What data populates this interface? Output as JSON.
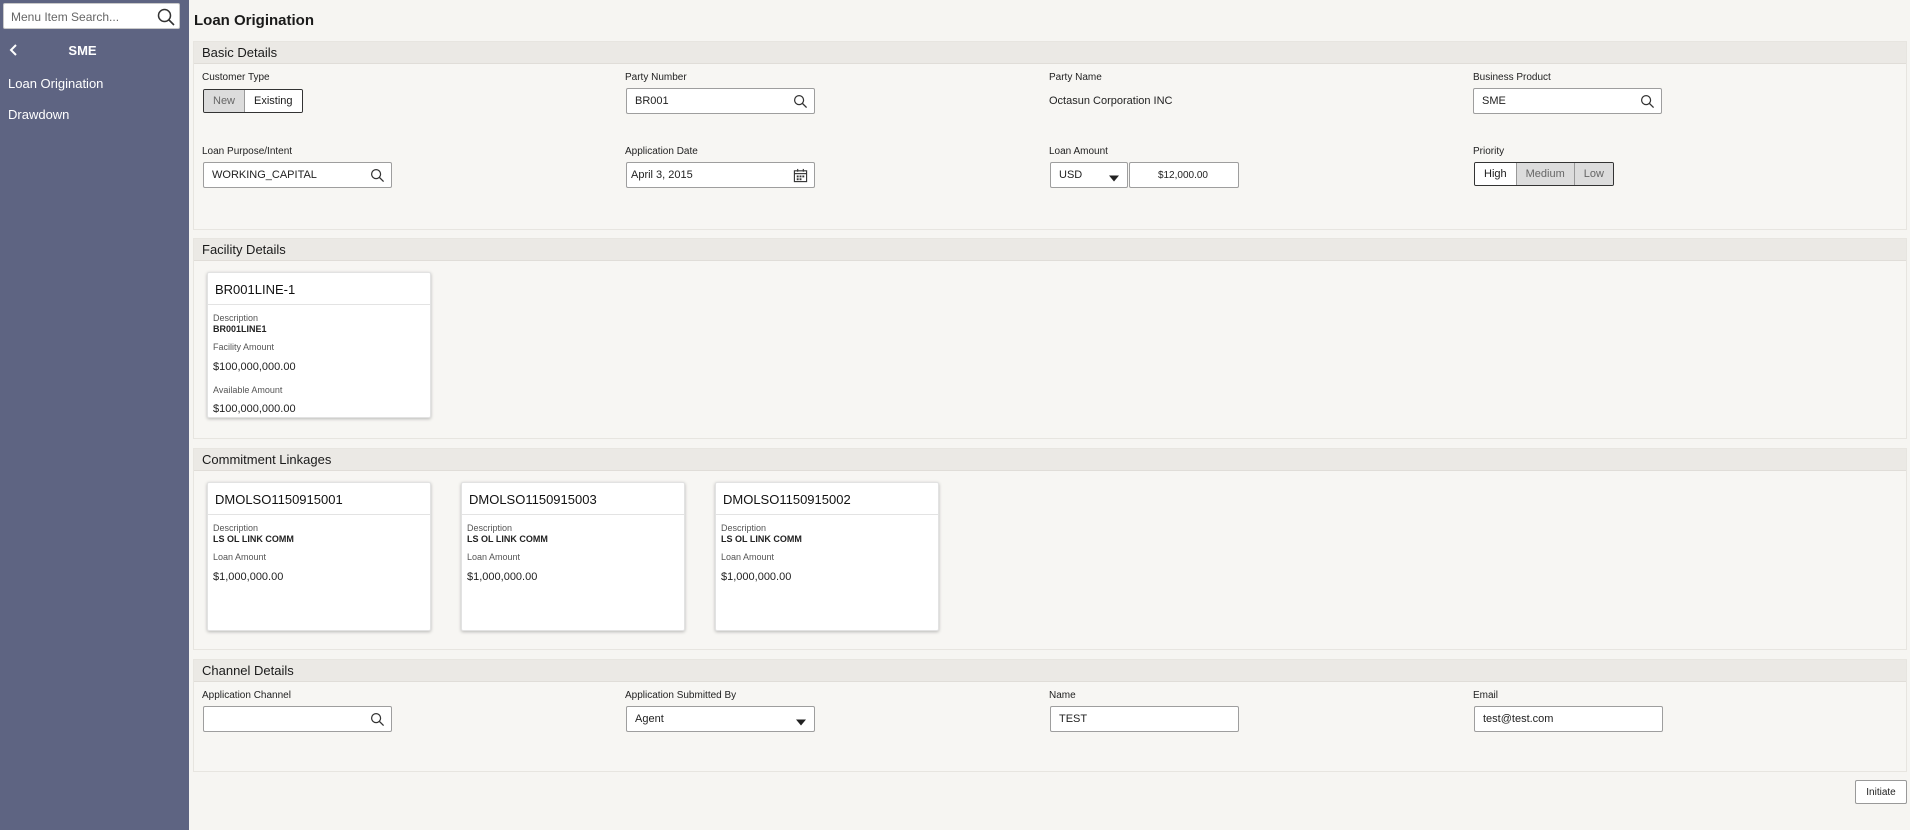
{
  "sidebar": {
    "search_placeholder": "Menu Item Search...",
    "title": "SME",
    "items": [
      {
        "label": "Loan Origination"
      },
      {
        "label": "Drawdown"
      }
    ]
  },
  "page": {
    "title": "Loan Origination"
  },
  "basic_details": {
    "title": "Basic Details",
    "customer_type": {
      "label": "Customer Type",
      "options": [
        "New",
        "Existing"
      ],
      "selected": "Existing"
    },
    "party_number": {
      "label": "Party Number",
      "value": "BR001"
    },
    "party_name": {
      "label": "Party Name",
      "value": "Octasun Corporation INC"
    },
    "business_product": {
      "label": "Business Product",
      "value": "SME"
    },
    "loan_purpose": {
      "label": "Loan Purpose/Intent",
      "value": "WORKING_CAPITAL"
    },
    "application_date": {
      "label": "Application Date",
      "value": "April 3, 2015"
    },
    "loan_amount": {
      "label": "Loan Amount",
      "currency": "USD",
      "value": "$12,000.00"
    },
    "priority": {
      "label": "Priority",
      "options": [
        "High",
        "Medium",
        "Low"
      ],
      "selected": "High"
    }
  },
  "facility_details": {
    "title": "Facility Details",
    "cards": [
      {
        "name": "BR001LINE-1",
        "description_label": "Description",
        "description": "BR001LINE1",
        "facility_amount_label": "Facility Amount",
        "facility_amount": "$100,000,000.00",
        "available_amount_label": "Available Amount",
        "available_amount": "$100,000,000.00"
      }
    ]
  },
  "commitment_linkages": {
    "title": "Commitment Linkages",
    "cards": [
      {
        "name": "DMOLSO1150915001",
        "description_label": "Description",
        "description": "LS OL LINK COMM",
        "loan_amount_label": "Loan Amount",
        "loan_amount": "$1,000,000.00"
      },
      {
        "name": "DMOLSO1150915003",
        "description_label": "Description",
        "description": "LS OL LINK COMM",
        "loan_amount_label": "Loan Amount",
        "loan_amount": "$1,000,000.00"
      },
      {
        "name": "DMOLSO1150915002",
        "description_label": "Description",
        "description": "LS OL LINK COMM",
        "loan_amount_label": "Loan Amount",
        "loan_amount": "$1,000,000.00"
      }
    ]
  },
  "channel_details": {
    "title": "Channel Details",
    "application_channel": {
      "label": "Application Channel",
      "value": ""
    },
    "submitted_by": {
      "label": "Application Submitted By",
      "value": "Agent"
    },
    "name": {
      "label": "Name",
      "value": "TEST"
    },
    "email": {
      "label": "Email",
      "value": "test@test.com"
    }
  },
  "actions": {
    "initiate_label": "Initiate"
  },
  "colors": {
    "sidebar_bg": "#5e6482",
    "section_header_bg": "#ebe9e5",
    "page_bg": "#f6f5f2"
  }
}
